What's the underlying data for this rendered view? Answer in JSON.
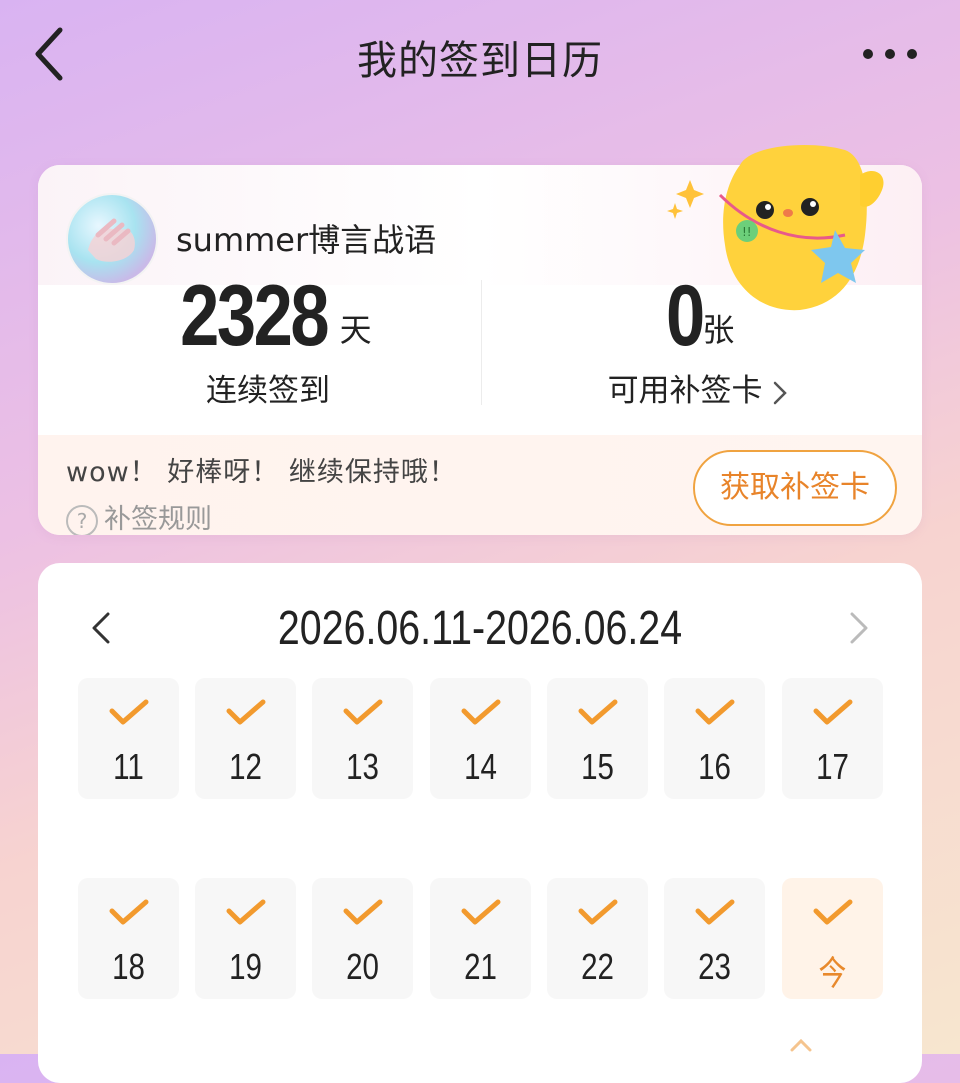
{
  "header": {
    "title": "我的签到日历",
    "back_icon": "chevron-left-icon",
    "more_icon": "more-horizontal-icon"
  },
  "profile": {
    "username": "summer博言战语",
    "streak": {
      "value": "2328",
      "unit": "天",
      "label": "连续签到"
    },
    "cards": {
      "value": "0",
      "unit": "张",
      "label": "可用补签卡"
    },
    "encouragement": "wow！ 好棒呀！ 继续保持哦！",
    "rules_label": "补签规则",
    "get_card_button": "获取补签卡"
  },
  "calendar": {
    "range": "2026.06.11-2026.06.24",
    "days": [
      {
        "label": "11",
        "signed": true
      },
      {
        "label": "12",
        "signed": true
      },
      {
        "label": "13",
        "signed": true
      },
      {
        "label": "14",
        "signed": true
      },
      {
        "label": "15",
        "signed": true
      },
      {
        "label": "16",
        "signed": true
      },
      {
        "label": "17",
        "signed": true
      },
      {
        "label": "18",
        "signed": true
      },
      {
        "label": "19",
        "signed": true
      },
      {
        "label": "20",
        "signed": true
      },
      {
        "label": "21",
        "signed": true
      },
      {
        "label": "22",
        "signed": true
      },
      {
        "label": "23",
        "signed": true
      },
      {
        "label": "今",
        "signed": true,
        "today": true
      }
    ]
  },
  "colors": {
    "accent": "#f29a2e",
    "today_bg": "#fff3e8",
    "cell_bg": "#f7f7f7"
  }
}
